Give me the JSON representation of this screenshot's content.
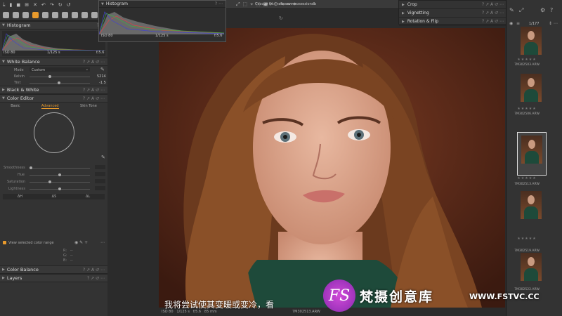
{
  "session_title": "Сессия без названия.cosessiondb",
  "left_panel": {
    "histogram_title": "Histogram",
    "hist_iso": "ISO 80",
    "hist_shutter": "1/125 s",
    "hist_aperture": "f/5.6",
    "white_balance": {
      "title": "White Balance",
      "mode_label": "Mode",
      "mode_value": "Custom",
      "kelvin_label": "Kelvin",
      "kelvin_value": "5214",
      "tint_label": "Tint",
      "tint_value": "-1.5"
    },
    "bw_title": "Black & White",
    "color_editor": {
      "title": "Color Editor",
      "tabs": [
        "Basic",
        "Advanced",
        "Skin Tone"
      ],
      "active_tab": "Advanced",
      "sliders": [
        "Smoothness",
        "Hue",
        "Saturation",
        "Lightness"
      ],
      "mode_buttons": [
        "ΔH",
        "ΔS",
        "ΔL"
      ],
      "view_range_label": "View selected color range",
      "rgb": [
        "R:",
        "G:",
        "B:"
      ],
      "dashes": "--"
    },
    "color_balance_title": "Color Balance",
    "layers_title": "Layers"
  },
  "float_hist": {
    "title": "Histogram",
    "iso": "ISO 80",
    "shutter": "1/125 s",
    "aperture": "f/5.6"
  },
  "right_tools": {
    "items": [
      "Crop",
      "Vignetting",
      "Rotation & Flip"
    ]
  },
  "browser": {
    "count": "1/177",
    "files": [
      "7M302503.ARW",
      "7M302506.ARW",
      "7M302513.ARW",
      "7M302519.ARW",
      "7M302522.ARW"
    ],
    "stars": "★★★★★"
  },
  "viewer_info": {
    "iso": "ISO 80",
    "shutter": "1/125 s",
    "aperture": "f/5.6",
    "focal": "85 mm",
    "filename": "7M302513.ARW"
  },
  "subtitle": "我将尝试使其变暖或变冷，看",
  "watermark": {
    "logo": "FS",
    "cn": "梵摄创意库",
    "url": "WWW.FSTVC.CC"
  },
  "colors": {
    "accent": "#e89a2c",
    "panel": "#333333",
    "bg": "#2b2b2b"
  }
}
